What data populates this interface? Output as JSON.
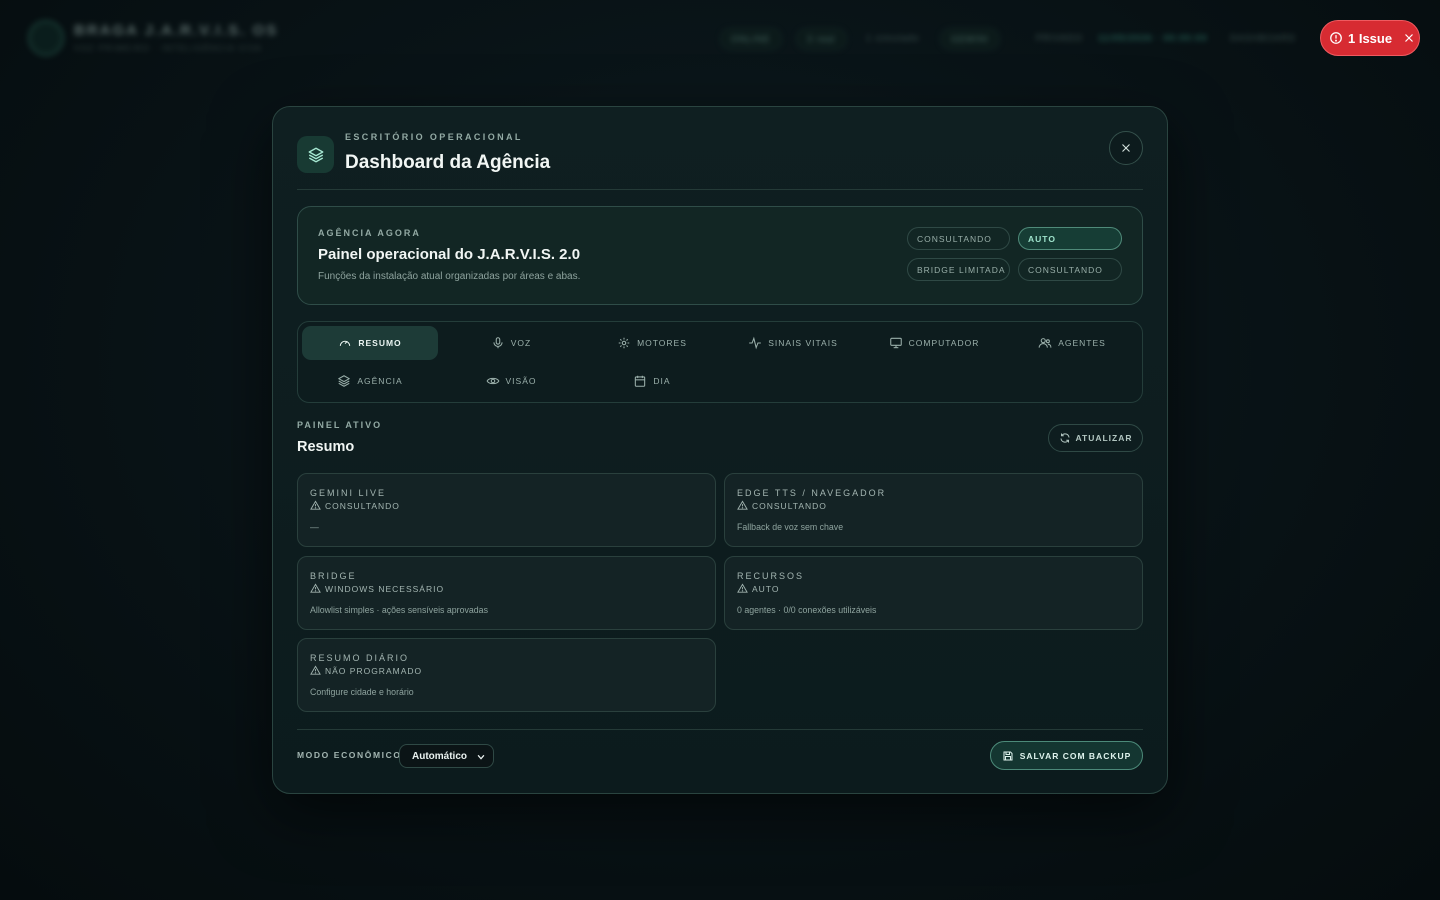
{
  "background": {
    "app_title": "BRAGA J.A.R.V.I.S. OS",
    "app_subtitle": "VOZ PRIMEIRO · INTELIGÊNCIA VIVA",
    "status_online": "ONLINE",
    "real_count": "3 real",
    "simulated_count": "1 simulado",
    "gemini_pill": "GEMINI",
    "privado": "PRIVADO",
    "datetime": "11/05/2026 · 00:00:00",
    "dashboard_link": "DASHBOARD"
  },
  "issue_badge": {
    "label": "1 Issue"
  },
  "modal": {
    "eyebrow": "ESCRITÓRIO OPERACIONAL",
    "title": "Dashboard da Agência",
    "agency": {
      "eyebrow": "AGÊNCIA AGORA",
      "title": "Painel operacional do J.A.R.V.I.S. 2.0",
      "description": "Funções da instalação atual organizadas por áreas e abas.",
      "chips": [
        "CONSULTANDO",
        "AUTO",
        "BRIDGE LIMITADA",
        "CONSULTANDO"
      ]
    },
    "tabs": [
      {
        "label": "RESUMO",
        "icon": "gauge-icon",
        "active": true
      },
      {
        "label": "VOZ",
        "icon": "microphone-icon"
      },
      {
        "label": "MOTORES",
        "icon": "engine-icon"
      },
      {
        "label": "SINAIS VITAIS",
        "icon": "pulse-icon"
      },
      {
        "label": "COMPUTADOR",
        "icon": "monitor-icon"
      },
      {
        "label": "AGENTES",
        "icon": "users-icon"
      },
      {
        "label": "AGÊNCIA",
        "icon": "layers-icon"
      },
      {
        "label": "VISÃO",
        "icon": "eye-icon"
      },
      {
        "label": "DIA",
        "icon": "calendar-icon"
      }
    ],
    "panel": {
      "eyebrow": "PAINEL ATIVO",
      "title": "Resumo",
      "refresh_label": "ATUALIZAR"
    },
    "cards": [
      {
        "title": "GEMINI LIVE",
        "status": "CONSULTANDO",
        "description": "—"
      },
      {
        "title": "EDGE TTS / NAVEGADOR",
        "status": "CONSULTANDO",
        "description": "Fallback de voz sem chave"
      },
      {
        "title": "BRIDGE",
        "status": "WINDOWS NECESSÁRIO",
        "description": "Allowlist simples · ações sensíveis aprovadas"
      },
      {
        "title": "RECURSOS",
        "status": "AUTO",
        "description": "0 agentes · 0/0 conexões utilizáveis"
      },
      {
        "title": "RESUMO DIÁRIO",
        "status": "NÃO PROGRAMADO",
        "description": "Configure cidade e horário"
      }
    ],
    "footer": {
      "eco_label": "MODO ECONÔMICO",
      "eco_value": "Automático",
      "save_label": "SALVAR COM BACKUP"
    }
  },
  "colors": {
    "accent": "#4f8a79",
    "issue": "#d72b32",
    "background": "#071013"
  }
}
